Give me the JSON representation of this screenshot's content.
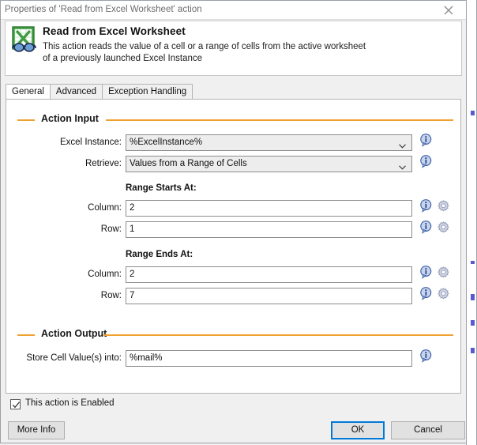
{
  "window": {
    "title": "Properties of 'Read from Excel Worksheet' action",
    "close_icon": "close-icon"
  },
  "header": {
    "icon": "excel-read-icon",
    "title": "Read from Excel Worksheet",
    "description_line1": "This action reads the value of a cell or a range of cells from the active worksheet",
    "description_line2": "of a previously launched Excel Instance"
  },
  "tabs": [
    {
      "label": "General",
      "active": true
    },
    {
      "label": "Advanced",
      "active": false
    },
    {
      "label": "Exception Handling",
      "active": false
    }
  ],
  "groups": {
    "action_input": "Action Input",
    "action_output": "Action Output"
  },
  "fields": {
    "excel_instance": {
      "label": "Excel Instance:",
      "value": "%ExcelInstance%",
      "type": "combobox"
    },
    "retrieve": {
      "label": "Retrieve:",
      "value": "Values from a Range of Cells",
      "type": "combobox"
    },
    "range_starts_at": {
      "heading": "Range Starts At:",
      "column": {
        "label": "Column:",
        "value": "2"
      },
      "row": {
        "label": "Row:",
        "value": "1"
      }
    },
    "range_ends_at": {
      "heading": "Range Ends At:",
      "column": {
        "label": "Column:",
        "value": "2"
      },
      "row": {
        "label": "Row:",
        "value": "7"
      }
    },
    "store_into": {
      "label": "Store Cell Value(s) into:",
      "value": "%mail%"
    }
  },
  "footer": {
    "enabled_checkbox_label": "This action is Enabled",
    "enabled_checked": true,
    "more_info_label": "More Info",
    "ok_label": "OK",
    "cancel_label": "Cancel"
  },
  "icons": {
    "info": "info-icon",
    "gear": "gear-icon",
    "chevron": "chevron-down-icon",
    "check": "check-icon"
  },
  "colors": {
    "accent_orange": "#f0a030",
    "focus_blue": "#0078d7",
    "excel_green": "#3f9c42",
    "info_blue": "#2a52a8",
    "title_gray": "#6d6d6d"
  }
}
